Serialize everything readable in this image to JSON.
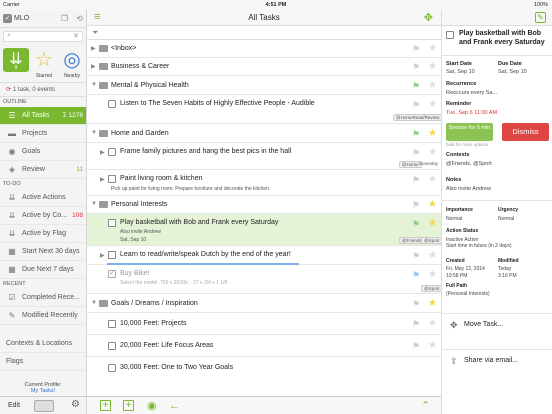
{
  "status_bar": {
    "carrier": "Carrier",
    "time": "4:51 PM",
    "battery": "100%"
  },
  "sidebar": {
    "app_name": "MLO",
    "quick": [
      {
        "icon": "to-do-icon",
        "label": "9"
      },
      {
        "icon": "star-icon",
        "label": "Starred"
      },
      {
        "icon": "compass-icon",
        "label": "Nearby"
      }
    ],
    "task_summary": "1 task, 0 events",
    "outline_label": "OUTLINE",
    "outline": [
      {
        "label": "All Tasks",
        "count": "Σ 1278"
      },
      {
        "label": "Projects",
        "count": ""
      },
      {
        "label": "Goals",
        "count": ""
      },
      {
        "label": "Review",
        "count": "11"
      }
    ],
    "todo_label": "TO-DO",
    "todo": [
      {
        "label": "Active Actions",
        "count": ""
      },
      {
        "label": "Active by Co...",
        "count": "108"
      },
      {
        "label": "Active by Flag",
        "count": ""
      },
      {
        "label": "Start Next 30 days",
        "count": ""
      },
      {
        "label": "Due Next 7 days",
        "count": ""
      }
    ],
    "recent_label": "RECENT",
    "recent": [
      {
        "label": "Completed Rece...",
        "count": ""
      },
      {
        "label": "Modified Recently",
        "count": ""
      }
    ],
    "contexts_label": "Contexts & Locations",
    "flags_label": "Flags",
    "profile_caption": "Current Profile:",
    "profile_name": "My Tasks!",
    "edit_label": "Edit"
  },
  "main": {
    "title": "All Tasks",
    "rows": [
      {
        "kind": "folder",
        "text": "<Inbox>"
      },
      {
        "kind": "folder",
        "text": "Business & Career"
      },
      {
        "kind": "folder",
        "text": "Mental & Physical Health"
      },
      {
        "kind": "task",
        "text": "Listen to The Seven Habits of Highly Effective People - Audible",
        "tags": [
          "@HomeRead/Review"
        ]
      },
      {
        "kind": "folder",
        "text": "Home and Garden"
      },
      {
        "kind": "task",
        "text": "Frame family pictures and hang the best pics in the hall",
        "tags": [
          "@Home",
          "Someday"
        ]
      },
      {
        "kind": "task",
        "text": "Paint living room & kitchen",
        "sub": "Pick up paint for living room. Prepare furniture and decorate the kitchen."
      },
      {
        "kind": "folder",
        "text": "Personal Interests"
      },
      {
        "kind": "task",
        "text": "Play basketball with Bob and Frank every Saturday",
        "sub": "Also invite Andrew",
        "sub2": "Sat, Sep 10",
        "tags": [
          "@Friends",
          "@Sport"
        ]
      },
      {
        "kind": "task",
        "text": "Learn to read/write/speak Dutch by the end of the year!"
      },
      {
        "kind": "task",
        "text": "Buy Bike!",
        "sub": "Select the model .700 x 20/28c - 27 x 3/4 x 1 1/8",
        "tags": [
          "@Sport"
        ]
      },
      {
        "kind": "folder",
        "text": "Goals / Dreams / Inspiration"
      },
      {
        "kind": "task",
        "text": "10,000 Feet: Projects"
      },
      {
        "kind": "task",
        "text": "20,000 Feet: Life Focus Areas"
      },
      {
        "kind": "task",
        "text": "30,000 Feet: One to Two Year Goals"
      }
    ]
  },
  "detail": {
    "title": "Play basketball with Bob and Frank every Saturday",
    "start_date_label": "Start Date",
    "start_date": "Sat, Sep 10",
    "due_date_label": "Due Date",
    "due_date": "Sat, Sep 10",
    "recurrence_label": "Recurrence",
    "recurrence": "Reoccurs every Sa...",
    "reminder_label": "Reminder",
    "reminder": "Tue, Sep 6 11:00 AM",
    "snooze": "Snooze for 5 min",
    "dismiss": "Dismiss",
    "hold_note": "hold for more options",
    "contexts_label": "Contexts",
    "contexts": "@Friends, @Sport",
    "notes_label": "Notes",
    "notes": "Also invite Andrew",
    "importance_label": "Importance",
    "importance": "Normal",
    "urgency_label": "Urgency",
    "urgency": "Normal",
    "action_status_label": "Action Status",
    "action_status": "Inactive Action",
    "action_status_note": "Start time in future (in 2 days)",
    "created_label": "Created",
    "created": "Fri, May 12, 2014",
    "created_time": "10:58 PM",
    "modified_label": "Modified",
    "modified": "Today",
    "modified_time": "3:16 PM",
    "full_path_label": "Full Path",
    "full_path": "(Personal Interests)",
    "move_task": "Move Task...",
    "share": "Share via email..."
  },
  "colors": {
    "accent": "#7ab830",
    "alert": "#e04545",
    "link": "#2a6fd0"
  }
}
